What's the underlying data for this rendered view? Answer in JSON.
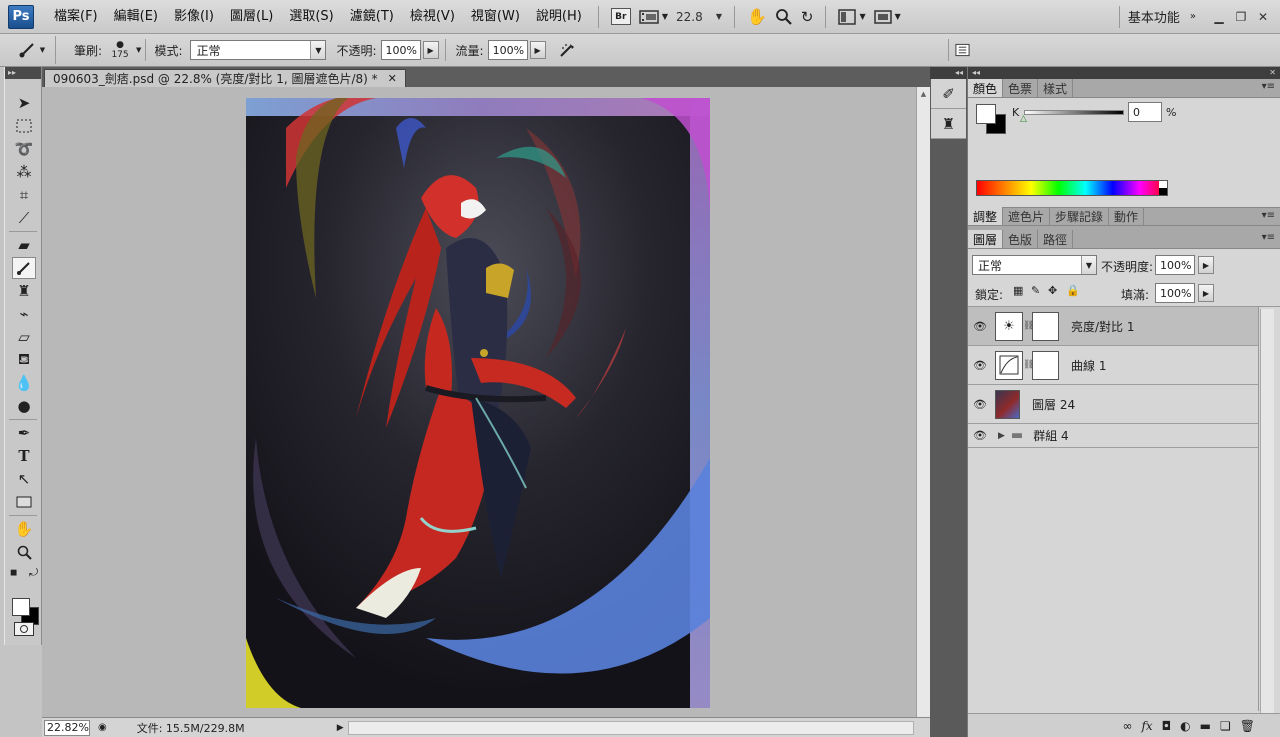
{
  "app": {
    "logo": "Ps"
  },
  "menu": {
    "items": [
      "檔案(F)",
      "編輯(E)",
      "影像(I)",
      "圖層(L)",
      "選取(S)",
      "濾鏡(T)",
      "檢視(V)",
      "視窗(W)",
      "說明(H)"
    ],
    "bridge_label": "Br",
    "zoom_value": "22.8",
    "workspace": "基本功能"
  },
  "options": {
    "brush_label": "筆刷:",
    "brush_size": "175",
    "mode_label": "模式:",
    "mode_value": "正常",
    "opacity_label": "不透明:",
    "opacity_value": "100%",
    "flow_label": "流量:",
    "flow_value": "100%"
  },
  "document": {
    "tab_title": "090603_劍痞.psd @ 22.8% (亮度/對比 1, 圖層遮色片/8) *",
    "close": "✕",
    "status_zoom": "22.82%",
    "status_info": "文件: 15.5M/229.8M"
  },
  "color_panel": {
    "tabs": [
      "顏色",
      "色票",
      "樣式"
    ],
    "channel_label": "K",
    "channel_value": "0",
    "percent": "%",
    "fg_color": "#ffffff",
    "bg_color": "#000000"
  },
  "adjust_panel": {
    "tabs": [
      "調整",
      "遮色片",
      "步驟記錄",
      "動作"
    ]
  },
  "layers_panel": {
    "tabs": [
      "圖層",
      "色版",
      "路徑"
    ],
    "blend_mode": "正常",
    "opacity_label": "不透明度:",
    "opacity_value": "100%",
    "lock_label": "鎖定:",
    "fill_label": "填滿:",
    "fill_value": "100%",
    "layers": [
      {
        "name": "亮度/對比 1",
        "type": "adjustment",
        "icon": "brightness-icon",
        "selected": true
      },
      {
        "name": "曲線 1",
        "type": "adjustment",
        "icon": "curves-icon",
        "selected": false
      },
      {
        "name": "圖層 24",
        "type": "pixel",
        "icon": "artwork-thumbnail",
        "selected": false
      },
      {
        "name": "群組 4",
        "type": "group",
        "icon": "folder-icon",
        "selected": false
      }
    ]
  }
}
